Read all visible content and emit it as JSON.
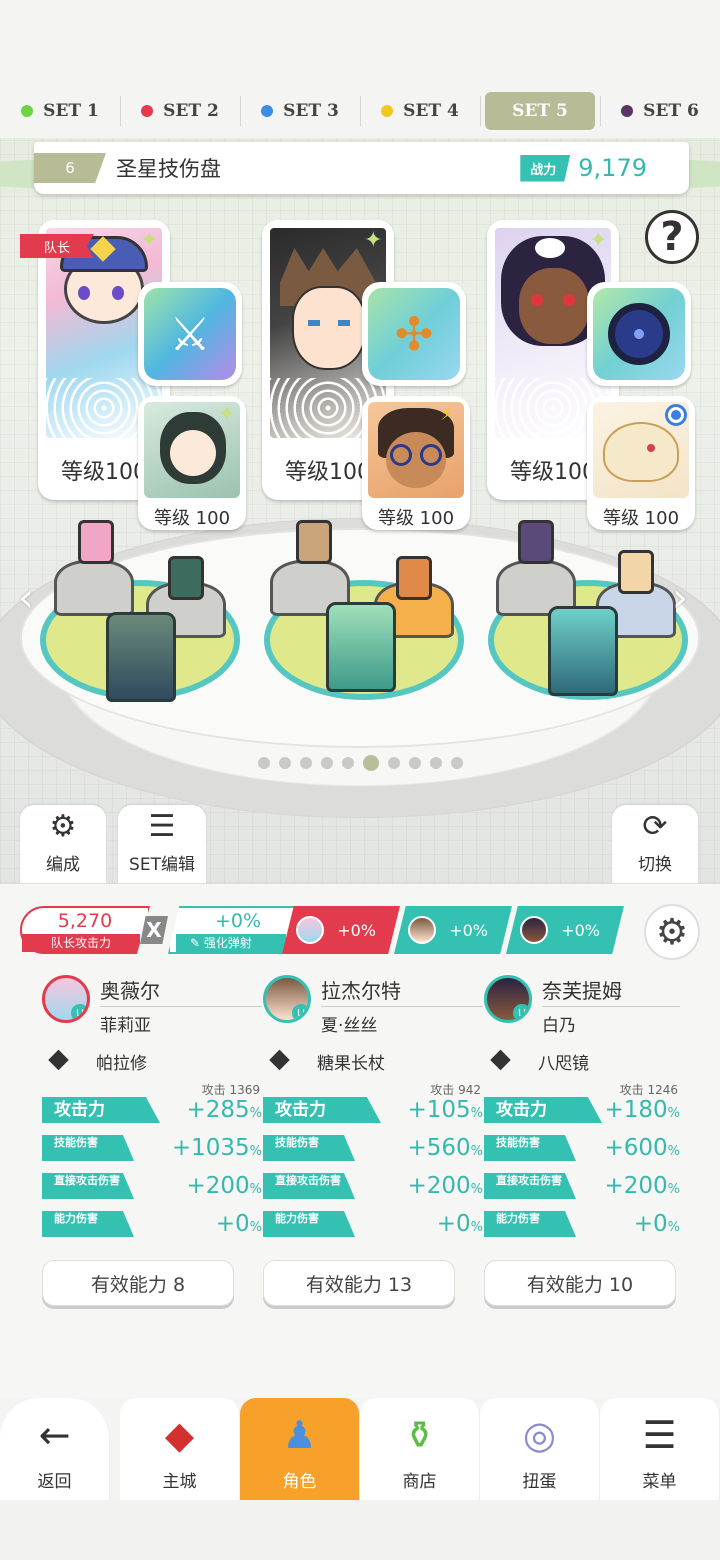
{
  "set_tabs": [
    {
      "label": "SET 1",
      "color": "#6dd33f",
      "active": false
    },
    {
      "label": "SET 2",
      "color": "#e23b4e",
      "active": false
    },
    {
      "label": "SET 3",
      "color": "#3b8ee6",
      "active": false
    },
    {
      "label": "SET 4",
      "color": "#f3c623",
      "active": false
    },
    {
      "label": "SET 5",
      "color": "",
      "active": true
    },
    {
      "label": "SET 6",
      "color": "#5a3466",
      "active": false
    }
  ],
  "deck": {
    "number": "6",
    "name": "圣星技伤盘",
    "power_label": "战力",
    "power_value": "9,179"
  },
  "help_icon": "?",
  "slots": [
    {
      "leader_label": "队长",
      "level": "等级100",
      "sub_level": "等级 100",
      "weapon_icon": "axe-icon",
      "sub_badge": "sparkle"
    },
    {
      "level": "等级100",
      "sub_level": "等级 100",
      "weapon_icon": "staff-icon",
      "sub_badge": "bolt"
    },
    {
      "level": "等级100",
      "sub_level": "等级 100",
      "weapon_icon": "mirror-icon",
      "sub_badge": "blue-dot"
    }
  ],
  "page_indicator": {
    "count": 10,
    "active": 5
  },
  "actions": {
    "formation": "编成",
    "set_edit": "SET编辑",
    "switch": "切换"
  },
  "atk_bar": {
    "leader_value": "5,270",
    "leader_label": "队长攻击力",
    "multiplier": "X",
    "boost_value": "+0%",
    "boost_label": "强化弹射",
    "bonuses": [
      "+0%",
      "+0%",
      "+0%"
    ]
  },
  "columns": [
    {
      "name": "奥薇尔",
      "sub_name": "菲莉亚",
      "weapon": "帕拉修",
      "atk_base_label": "攻击",
      "atk_base": "1369",
      "stats": [
        {
          "label": "攻击力",
          "value": "+285",
          "unit": "%"
        },
        {
          "label": "技能伤害",
          "value": "+1035",
          "unit": "%"
        },
        {
          "label": "直接攻击伤害",
          "value": "+200",
          "unit": "%"
        },
        {
          "label": "能力伤害",
          "value": "+0",
          "unit": "%"
        }
      ],
      "effective": "有效能力 8"
    },
    {
      "name": "拉杰尔特",
      "sub_name": "夏·丝丝",
      "weapon": "糖果长杖",
      "atk_base_label": "攻击",
      "atk_base": "942",
      "stats": [
        {
          "label": "攻击力",
          "value": "+105",
          "unit": "%"
        },
        {
          "label": "技能伤害",
          "value": "+560",
          "unit": "%"
        },
        {
          "label": "直接攻击伤害",
          "value": "+200",
          "unit": "%"
        },
        {
          "label": "能力伤害",
          "value": "+0",
          "unit": "%"
        }
      ],
      "effective": "有效能力 13"
    },
    {
      "name": "奈芙提姆",
      "sub_name": "白乃",
      "weapon": "八咫镜",
      "atk_base_label": "攻击",
      "atk_base": "1246",
      "stats": [
        {
          "label": "攻击力",
          "value": "+180",
          "unit": "%"
        },
        {
          "label": "技能伤害",
          "value": "+600",
          "unit": "%"
        },
        {
          "label": "直接攻击伤害",
          "value": "+200",
          "unit": "%"
        },
        {
          "label": "能力伤害",
          "value": "+0",
          "unit": "%"
        }
      ],
      "effective": "有效能力 10"
    }
  ],
  "bottom_nav": [
    {
      "label": "返回",
      "icon": "back-arrow-icon",
      "active": false
    },
    {
      "label": "主城",
      "icon": "castle-icon",
      "active": false
    },
    {
      "label": "角色",
      "icon": "character-icon",
      "active": true
    },
    {
      "label": "商店",
      "icon": "shop-icon",
      "active": false
    },
    {
      "label": "扭蛋",
      "icon": "gacha-icon",
      "active": false
    },
    {
      "label": "菜单",
      "icon": "menu-icon",
      "active": false
    }
  ],
  "colors": {
    "accent": "#35c1b2",
    "leader_red": "#e23b4e",
    "active_tab": "#b7bc97",
    "nav_active": "#f7a12a"
  }
}
